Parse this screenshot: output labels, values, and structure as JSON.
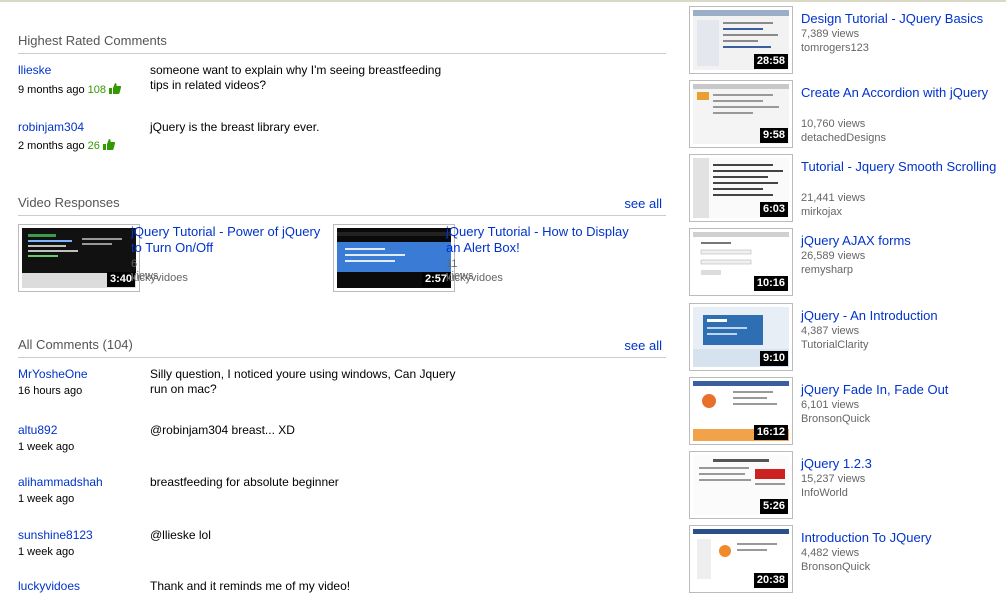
{
  "highest_rated": {
    "title": "Highest Rated Comments",
    "comments": [
      {
        "user": "llieske",
        "time": "9 months ago",
        "rating": "108",
        "text": "someone want to explain why I'm seeing breastfeeding tips in related videos?"
      },
      {
        "user": "robinjam304",
        "time": "2 months ago",
        "rating": "26",
        "text": "jQuery is the breast library ever."
      }
    ]
  },
  "video_responses": {
    "title": "Video Responses",
    "see_all": "see all",
    "items": [
      {
        "title": "jQuery Tutorial - Power of jQuery to Turn On/Off",
        "views": "6 views",
        "author": "luckyvidoes",
        "duration": "3:40"
      },
      {
        "title": "jQuery Tutorial - How to Display an Alert Box!",
        "views": "11 views",
        "author": "luckyvidoes",
        "duration": "2:57"
      }
    ]
  },
  "all_comments": {
    "title": "All Comments (104)",
    "see_all": "see all",
    "comments": [
      {
        "user": "MrYosheOne",
        "time": "16 hours ago",
        "text": "Silly question, I noticed youre using windows, Can Jquery run on mac?"
      },
      {
        "user": "altu892",
        "time": "1 week ago",
        "text": "@robinjam304 breast... XD"
      },
      {
        "user": "alihammadshah",
        "time": "1 week ago",
        "text": "breastfeeding for absolute beginner"
      },
      {
        "user": "sunshine8123",
        "time": "1 week ago",
        "text": "@llieske lol"
      },
      {
        "user": "luckyvidoes",
        "time": "",
        "text": "Thank and it reminds me of my video!"
      }
    ]
  },
  "related": [
    {
      "title": "Design Tutorial - JQuery Basics",
      "views": "7,389 views",
      "author": "tomrogers123",
      "duration": "28:58"
    },
    {
      "title": "Create An Accordion with jQuery",
      "views": "10,760 views",
      "author": "detachedDesigns",
      "duration": "9:58"
    },
    {
      "title": "Tutorial - Jquery Smooth Scrolling",
      "views": "21,441 views",
      "author": "mirkojax",
      "duration": "6:03"
    },
    {
      "title": "jQuery AJAX forms",
      "views": "26,589 views",
      "author": "remysharp",
      "duration": "10:16"
    },
    {
      "title": "jQuery - An Introduction",
      "views": "4,387 views",
      "author": "TutorialClarity",
      "duration": "9:10"
    },
    {
      "title": "jQuery Fade In, Fade Out",
      "views": "6,101 views",
      "author": "BronsonQuick",
      "duration": "16:12"
    },
    {
      "title": "jQuery 1.2.3",
      "views": "15,237 views",
      "author": "InfoWorld",
      "duration": "5:26"
    },
    {
      "title": "Introduction To JQuery",
      "views": "4,482 views",
      "author": "BronsonQuick",
      "duration": "20:38"
    }
  ]
}
